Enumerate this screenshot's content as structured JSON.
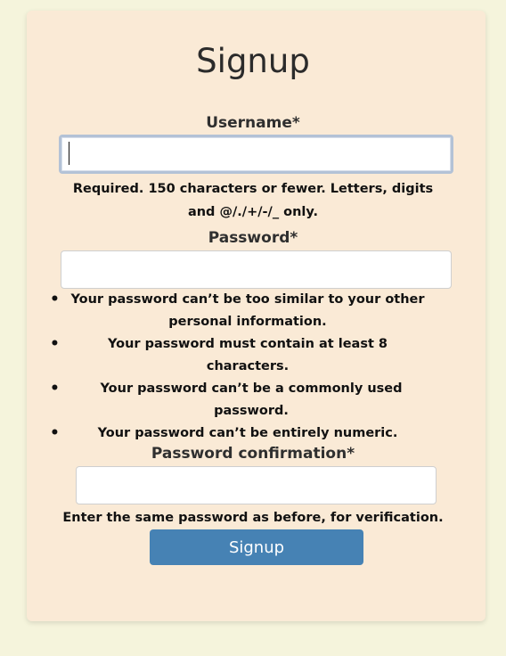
{
  "form": {
    "title": "Signup",
    "username": {
      "label": "Username*",
      "value": "",
      "help": "Required. 150 characters or fewer. Letters, digits and @/./+/-/_ only."
    },
    "password": {
      "label": "Password*",
      "value": "",
      "rules": [
        "Your password can’t be too similar to your other personal information.",
        "Your password must contain at least 8 characters.",
        "Your password can’t be a commonly used password.",
        "Your password can’t be entirely numeric."
      ]
    },
    "password_confirmation": {
      "label": "Password confirmation*",
      "value": "",
      "help": "Enter the same password as before, for verification."
    },
    "submit_label": "Signup"
  },
  "colors": {
    "page_background": "#f5f4dc",
    "card_background": "#faead6",
    "button_background": "#4682b4",
    "button_text": "#ffffff"
  }
}
